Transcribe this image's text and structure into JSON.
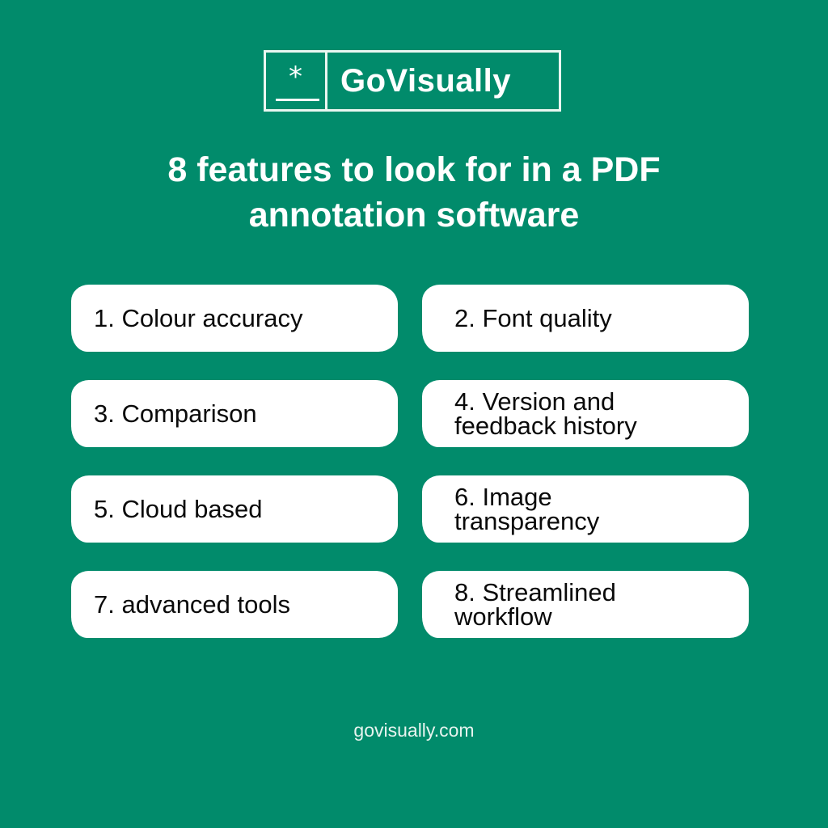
{
  "colors": {
    "background": "#018B6B",
    "card": "#FFFFFF",
    "text_on_card": "#0A0A0A",
    "text_on_background": "#FFFFFF"
  },
  "logo": {
    "icon": "asterisk-icon",
    "mark": "*",
    "brand_name": "GoVisually"
  },
  "title": {
    "line1": "8 features to look for in a PDF",
    "line2": "annotation software"
  },
  "features": [
    {
      "label": "1.  Colour accuracy"
    },
    {
      "label": "2. Font quality"
    },
    {
      "label": "3. Comparison"
    },
    {
      "label": "4. Version and\nfeedback history"
    },
    {
      "label": "5. Cloud based"
    },
    {
      "label": "6. Image\ntransparency"
    },
    {
      "label": "7. advanced tools"
    },
    {
      "label": "8. Streamlined\nworkflow"
    }
  ],
  "footer": {
    "website": "govisually.com"
  }
}
